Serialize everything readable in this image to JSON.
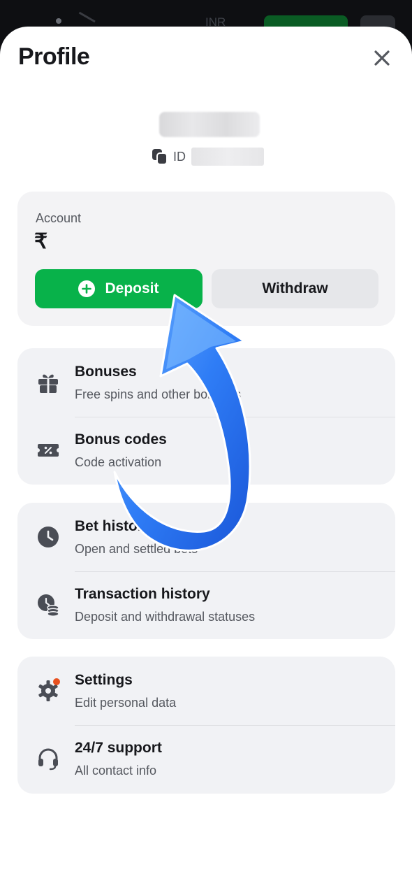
{
  "topbar": {
    "currency": "INR"
  },
  "header": {
    "title": "Profile"
  },
  "profile": {
    "id_label": "ID"
  },
  "account": {
    "label": "Account",
    "currency_symbol": "₹",
    "deposit_label": "Deposit",
    "withdraw_label": "Withdraw"
  },
  "menu": {
    "bonuses": {
      "title": "Bonuses",
      "subtitle": "Free spins and other bonuses"
    },
    "bonus_codes": {
      "title": "Bonus codes",
      "subtitle": "Code activation"
    },
    "bet_history": {
      "title": "Bet history",
      "subtitle": "Open and settled bets"
    },
    "transaction_history": {
      "title": "Transaction history",
      "subtitle": "Deposit and withdrawal statuses"
    },
    "settings": {
      "title": "Settings",
      "subtitle": "Edit personal data"
    },
    "support": {
      "title": "24/7 support",
      "subtitle": "All contact info"
    }
  },
  "colors": {
    "accent_green": "#08b24a",
    "card_bg": "#f1f2f5",
    "notification_dot": "#e8501e",
    "arrow_blue": "#2f7df6"
  },
  "icons": {
    "close": "close-icon",
    "copy": "copy-icon",
    "plus": "plus-circle-icon",
    "bonuses": "gift-icon",
    "bonus_codes": "coupon-icon",
    "bet_history": "clock-icon",
    "transaction_history": "clock-coins-icon",
    "settings": "gear-icon",
    "support": "headset-icon"
  }
}
